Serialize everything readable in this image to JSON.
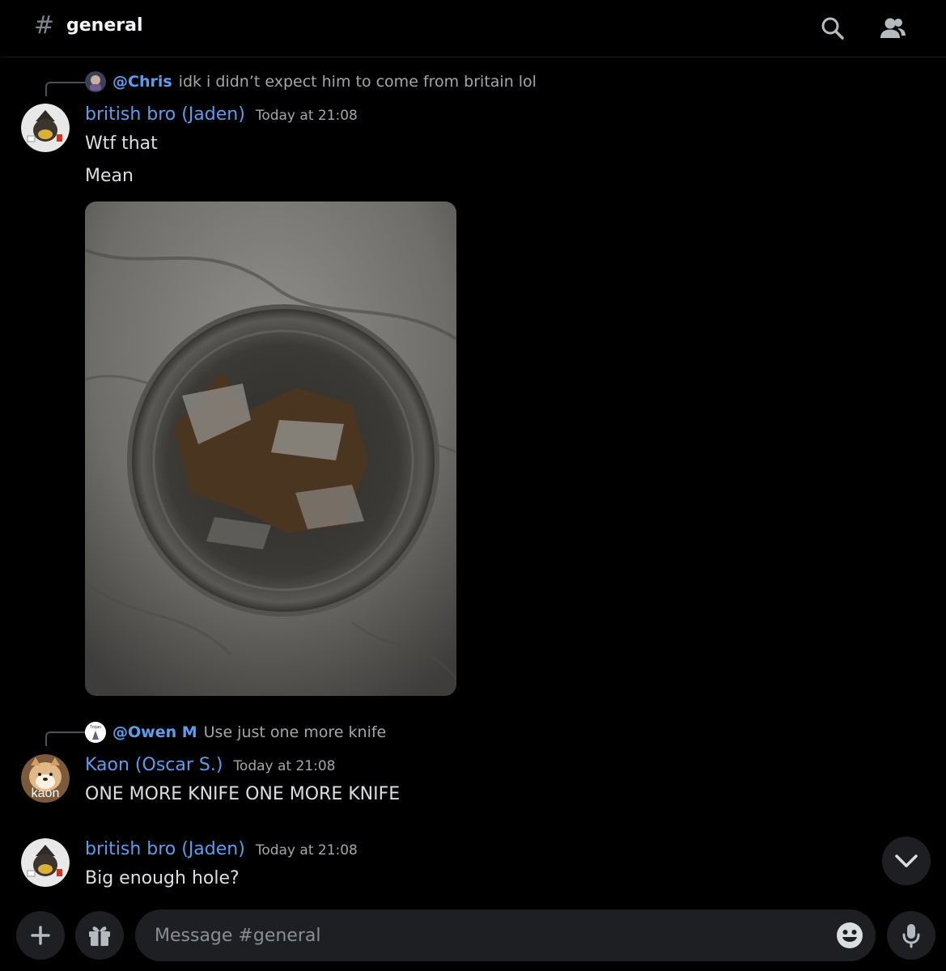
{
  "header": {
    "hash_symbol": "#",
    "channel_name": "general"
  },
  "messages": [
    {
      "reply_to": {
        "name": "@Chris",
        "text": "idk i didn’t expect him to come from britain lol"
      },
      "author": "british bro (Jaden)",
      "timestamp": "Today at 21:08",
      "lines": [
        "Wtf that",
        "Mean"
      ],
      "has_image_attachment": true
    },
    {
      "reply_to": {
        "name": "@Owen M",
        "text": "Use just one more knife",
        "avatar_label": "Trojan"
      },
      "author": "Kaon (Oscar S.)",
      "avatar_label": "kaon",
      "timestamp": "Today at 21:08",
      "lines": [
        "ONE MORE KNIFE ONE MORE KNIFE"
      ]
    },
    {
      "author": "british bro (Jaden)",
      "timestamp": "Today at 21:08",
      "lines": [
        "Big enough hole?"
      ]
    }
  ],
  "composer": {
    "placeholder": "Message #general"
  },
  "colors": {
    "background": "#000000",
    "username": "#5c9ded",
    "surface": "#1e1f22"
  },
  "icons": [
    "hash-icon",
    "search-icon",
    "members-icon",
    "chevron-down-icon",
    "plus-icon",
    "gift-icon",
    "emoji-icon",
    "microphone-icon"
  ]
}
